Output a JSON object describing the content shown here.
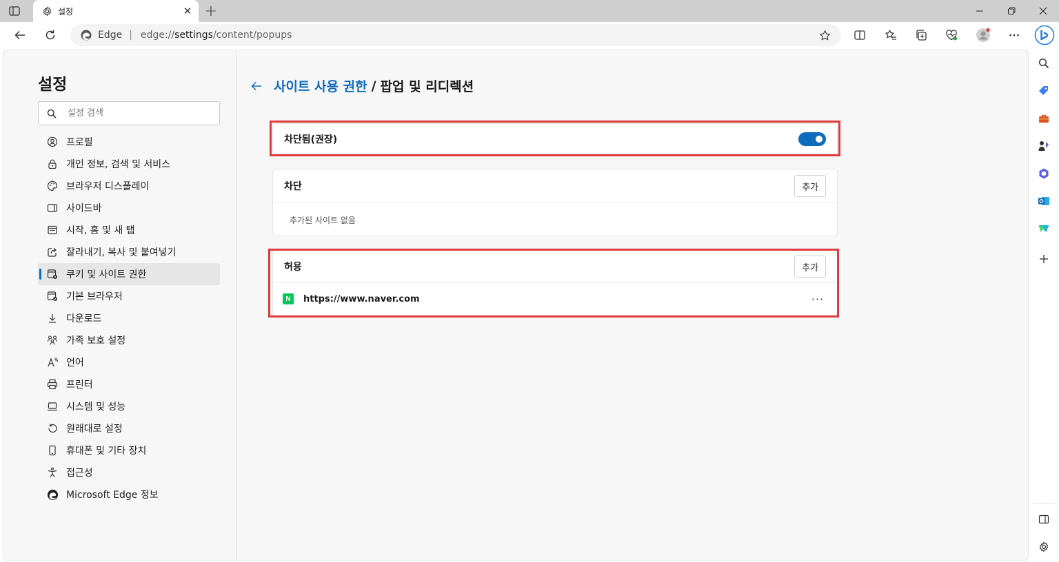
{
  "browser": {
    "tab_title": "설정",
    "tab_close": "✕",
    "new_tab": "+",
    "address_brand": "Edge",
    "address_url_prefix": "edge://",
    "address_url_host": "settings",
    "address_url_path": "/content/popups"
  },
  "nav": {
    "title": "설정",
    "search_placeholder": "설정 검색",
    "items": [
      {
        "label": "프로필",
        "icon": "profile-icon"
      },
      {
        "label": "개인 정보, 검색 및 서비스",
        "icon": "lock-icon"
      },
      {
        "label": "브라우저 디스플레이",
        "icon": "palette-icon"
      },
      {
        "label": "사이드바",
        "icon": "sidebar-icon"
      },
      {
        "label": "시작, 홈 및 새 탭",
        "icon": "home-tab-icon"
      },
      {
        "label": "잘라내기, 복사 및 붙여넣기",
        "icon": "share-icon"
      },
      {
        "label": "쿠키 및 사이트 권한",
        "icon": "site-permissions-icon",
        "active": true
      },
      {
        "label": "기본 브라우저",
        "icon": "default-browser-icon"
      },
      {
        "label": "다운로드",
        "icon": "download-icon"
      },
      {
        "label": "가족 보호 설정",
        "icon": "family-icon"
      },
      {
        "label": "언어",
        "icon": "language-icon"
      },
      {
        "label": "프린터",
        "icon": "printer-icon"
      },
      {
        "label": "시스템 및 성능",
        "icon": "laptop-icon"
      },
      {
        "label": "원래대로 설정",
        "icon": "reset-icon"
      },
      {
        "label": "휴대폰 및 기타 장치",
        "icon": "phone-icon"
      },
      {
        "label": "접근성",
        "icon": "accessibility-icon"
      },
      {
        "label": "Microsoft Edge 정보",
        "icon": "edge-logo-icon"
      }
    ]
  },
  "page": {
    "breadcrumb_link": "사이트 사용 권한",
    "breadcrumb_sep": "/",
    "breadcrumb_current": "팝업 및 리디렉션",
    "blocked_toggle_label": "차단됨(권장)",
    "blocked_toggle_on": true,
    "block_section": {
      "label": "차단",
      "add_label": "추가",
      "empty_text": "추가된 사이트 없음"
    },
    "allow_section": {
      "label": "허용",
      "add_label": "추가",
      "sites": [
        {
          "url": "https://www.naver.com",
          "favicon_letter": "N",
          "more": "···"
        }
      ]
    }
  },
  "colors": {
    "accent": "#0f6cbd",
    "highlight": "#e0393e",
    "naver_green": "#03c75a"
  }
}
